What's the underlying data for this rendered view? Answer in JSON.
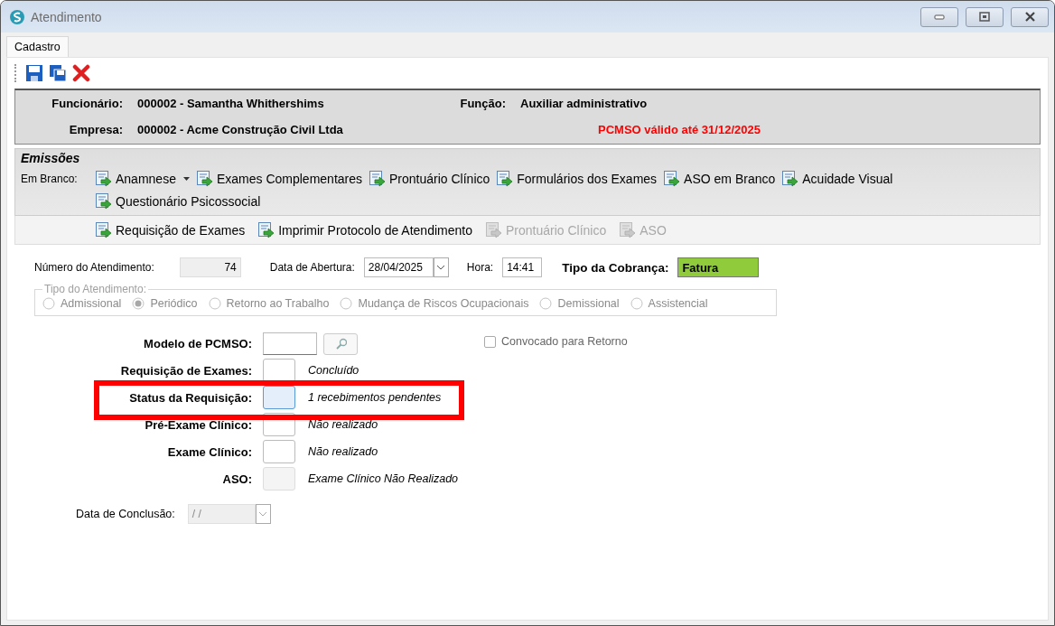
{
  "window": {
    "title": "Atendimento"
  },
  "tabs": [
    {
      "label": "Cadastro",
      "selected": true
    }
  ],
  "header": {
    "employee_label": "Funcionário:",
    "employee": "000002 - Samantha Whithershims",
    "role_label": "Função:",
    "role": "Auxiliar administrativo",
    "company_label": "Empresa:",
    "company": "000002 - Acme Construção Civil Ltda",
    "pcmso_notice": "PCMSO válido até 31/12/2025"
  },
  "emissions": {
    "title": "Emissões",
    "blank_label": "Em Branco:",
    "blank_items": [
      {
        "label": "Anamnese",
        "dropdown": true
      },
      {
        "label": "Exames Complementares",
        "dropdown": false
      },
      {
        "label": "Prontuário Clínico",
        "dropdown": false
      },
      {
        "label": "Formulários dos Exames",
        "dropdown": false
      },
      {
        "label": "ASO em Branco",
        "dropdown": false
      },
      {
        "label": "Acuidade Visual",
        "dropdown": false
      },
      {
        "label": "Questionário Psicossocial",
        "dropdown": false
      }
    ],
    "print_items": [
      {
        "label": "Requisição de Exames",
        "disabled": false
      },
      {
        "label": "Imprimir Protocolo de Atendimento",
        "disabled": false
      },
      {
        "label": "Prontuário Clínico",
        "disabled": true
      },
      {
        "label": "ASO",
        "disabled": true
      }
    ]
  },
  "form": {
    "number_label": "Número do Atendimento:",
    "number": "74",
    "opening_label": "Data de Abertura:",
    "opening_date": "28/04/2025",
    "time_label": "Hora:",
    "time": "14:41",
    "billing_label": "Tipo da Cobrança:",
    "billing": "Fatura",
    "type_group": {
      "legend": "Tipo do Atendimento:",
      "disabled": true,
      "options": [
        {
          "label": "Admissional",
          "selected": false
        },
        {
          "label": "Periódico",
          "selected": true
        },
        {
          "label": "Retorno ao Trabalho",
          "selected": false
        },
        {
          "label": "Mudança de Riscos Ocupacionais",
          "selected": false
        },
        {
          "label": "Demissional",
          "selected": false
        },
        {
          "label": "Assistencial",
          "selected": false
        }
      ]
    }
  },
  "status_rows": [
    {
      "kind": "lookup",
      "label": "Modelo de PCMSO:",
      "focused": false,
      "disabled": false,
      "highlighted": false
    },
    {
      "kind": "status",
      "label": "Requisição de Exames:",
      "note": "Concluído",
      "focused": false,
      "disabled": false,
      "highlighted": false
    },
    {
      "kind": "status",
      "label": "Status da Requisição:",
      "note": "1 recebimentos pendentes",
      "focused": true,
      "disabled": false,
      "highlighted": true
    },
    {
      "kind": "status",
      "label": "Pré-Exame Clínico:",
      "note": "Não realizado",
      "focused": false,
      "disabled": false,
      "highlighted": false
    },
    {
      "kind": "status",
      "label": "Exame Clínico:",
      "note": "Não realizado",
      "focused": false,
      "disabled": false,
      "highlighted": false
    },
    {
      "kind": "status",
      "label": "ASO:",
      "note": "Exame Clínico Não Realizado",
      "focused": false,
      "disabled": true,
      "highlighted": false
    }
  ],
  "recall": {
    "label": "Convocado para Retorno",
    "checked": false
  },
  "conclusion": {
    "label": "Data de Conclusão:",
    "value": "/ /",
    "disabled": true
  }
}
